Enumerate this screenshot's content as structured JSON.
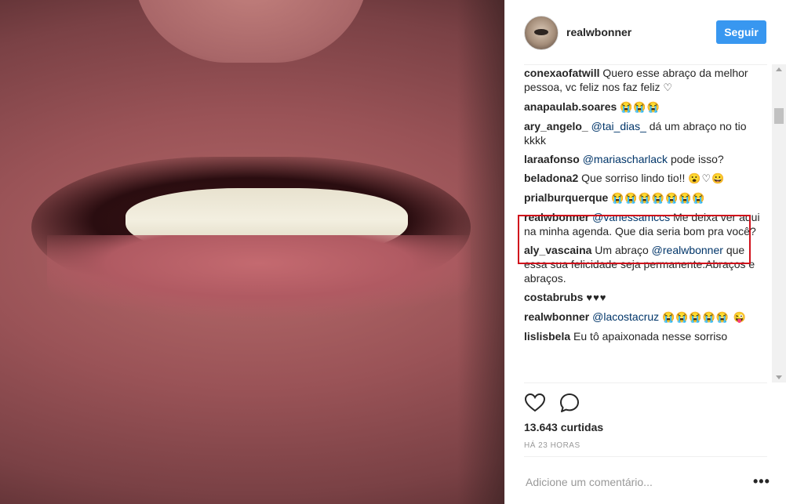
{
  "post": {
    "username": "realwbonner",
    "follow_label": "Seguir",
    "likes": "13.643 curtidas",
    "time": "HÁ 23 HORAS",
    "comment_placeholder": "Adicione um comentário...",
    "more_label": "•••"
  },
  "comments": [
    {
      "user": "conexaofatwill",
      "mention": "",
      "text": "Quero esse abraço da melhor pessoa, vc feliz nos faz feliz",
      "emoji": "♡"
    },
    {
      "user": "anapaulab.soares",
      "mention": "",
      "text": "",
      "emoji": "😭😭😭"
    },
    {
      "user": "ary_angelo_",
      "mention": "@tai_dias_",
      "text": "dá um abraço no tio kkkk",
      "emoji": ""
    },
    {
      "user": "laraafonso",
      "mention": "@mariascharlack",
      "text": "pode isso?",
      "emoji": ""
    },
    {
      "user": "beladona2",
      "mention": "",
      "text": "Que sorriso lindo tio!!",
      "emoji": "😮♡😀"
    },
    {
      "user": "prialburquerque",
      "mention": "",
      "text": "",
      "emoji": "😭😭😭😭😭😭😭"
    },
    {
      "user": "realwbonner",
      "mention": "@vanessamccs",
      "text": "Me deixa ver aqui na minha agenda. Que dia seria bom pra você?",
      "emoji": ""
    },
    {
      "user": "aly_vascaina",
      "mention": "",
      "text": "Um abraço",
      "mention2": "@realwbonner",
      "text2": "que essa sua felicidade seja permanente.Abraços e abraços.",
      "emoji": ""
    },
    {
      "user": "costabrubs",
      "mention": "",
      "text": "",
      "emoji": "♥♥♥"
    },
    {
      "user": "realwbonner",
      "mention": "@lacostacruz",
      "text": "",
      "emoji": "😭😭😭😭😭 😜"
    },
    {
      "user": "lislisbela",
      "mention": "",
      "text": "Eu tô apaixonada nesse sorriso",
      "emoji": ""
    }
  ],
  "icons": {
    "like": "heart-outline-icon",
    "comment": "speech-bubble-icon"
  },
  "colors": {
    "follow": "#3897f0",
    "highlight": "#d0111b",
    "mention": "#003569"
  }
}
